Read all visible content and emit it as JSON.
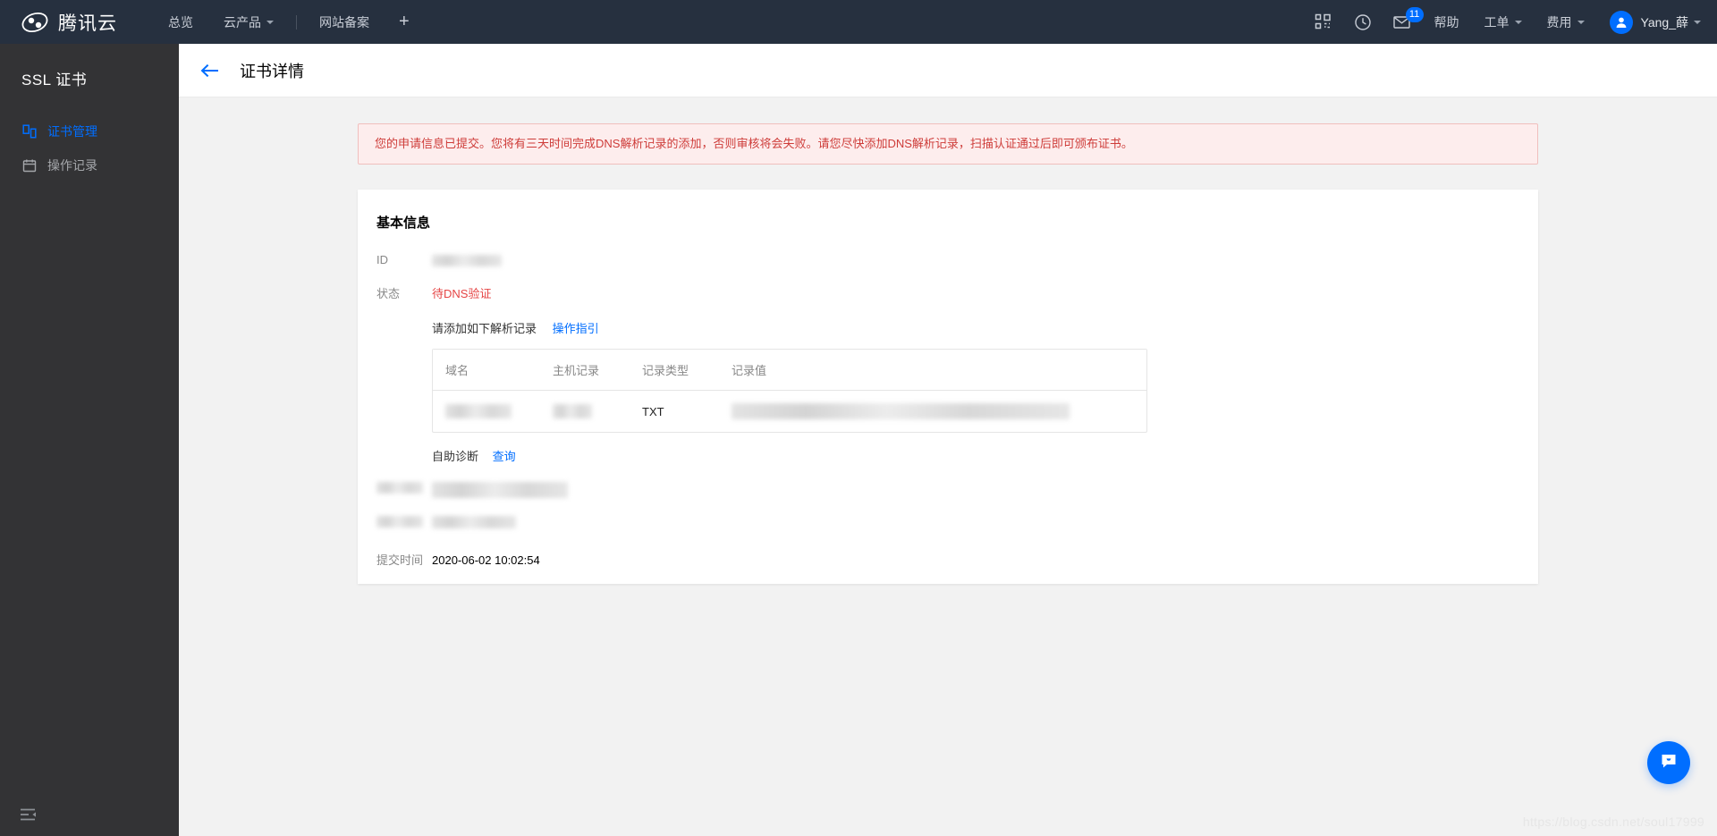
{
  "header": {
    "brand": "腾讯云",
    "brand_logo_icon": "cloud-logo-icon",
    "nav": [
      {
        "label": "总览",
        "name": "nav-overview",
        "caret": false
      },
      {
        "label": "云产品",
        "name": "nav-cloud-products",
        "caret": true
      },
      {
        "label": "网站备案",
        "name": "nav-icp-filing",
        "caret": false
      }
    ],
    "add_tab_label": "+",
    "icons": {
      "qrcode": "qrcode-icon",
      "clock": "clock-icon",
      "mail": "mail-icon"
    },
    "mail_badge": "11",
    "right_items": [
      {
        "label": "帮助",
        "name": "help-menu",
        "caret": false
      },
      {
        "label": "工单",
        "name": "ticket-menu",
        "caret": true
      },
      {
        "label": "费用",
        "name": "billing-menu",
        "caret": true
      }
    ],
    "user_name": "Yang_薛"
  },
  "sidebar": {
    "title": "SSL 证书",
    "items": [
      {
        "label": "证书管理",
        "icon": "certificate-icon",
        "active": true
      },
      {
        "label": "操作记录",
        "icon": "calendar-icon",
        "active": false
      }
    ],
    "collapse_icon": "collapse-sidebar-icon"
  },
  "page": {
    "back_icon": "back-arrow-icon",
    "title": "证书详情"
  },
  "alert": {
    "text": "您的申请信息已提交。您将有三天时间完成DNS解析记录的添加，否则审核将会失败。请您尽快添加DNS解析记录，扫描认证通过后即可颁布证书。",
    "border_color": "#f0bfbd",
    "bg_color": "#fdeded",
    "text_color": "#ce3c39"
  },
  "card": {
    "title": "基本信息",
    "fields": {
      "id_label": "ID",
      "id_value_redacted": true,
      "status_label": "状态",
      "status_value": "待DNS验证",
      "status_color": "#e54545",
      "instruction": "请添加如下解析记录",
      "instruction_link": "操作指引",
      "diagnose_label": "自助诊断",
      "diagnose_link": "查询",
      "submit_time_label": "提交时间",
      "submit_time_value": "2020-06-02 10:02:54"
    },
    "table": {
      "headers": [
        "域名",
        "主机记录",
        "记录类型",
        "记录值"
      ],
      "rows": [
        {
          "domain_redacted": true,
          "host_redacted": true,
          "record_type": "TXT",
          "record_value_redacted": true
        }
      ]
    },
    "redacted_rows": [
      {
        "label_redacted": true,
        "value_redacted": true
      },
      {
        "label_redacted": true,
        "value_redacted": true
      }
    ]
  },
  "chat": {
    "icon": "chat-bubble-icon",
    "color": "#006eff"
  },
  "watermark": "https://blog.csdn.net/soul17999"
}
